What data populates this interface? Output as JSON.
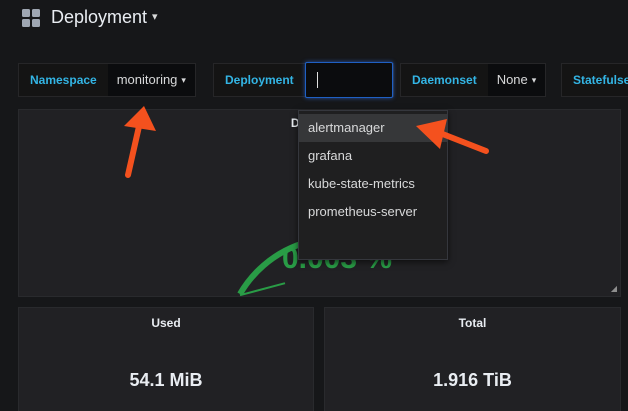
{
  "header": {
    "title": "Deployment"
  },
  "variables": [
    {
      "label": "Namespace",
      "value": "monitoring"
    },
    {
      "label": "Deployment",
      "value": ""
    },
    {
      "label": "Daemonset",
      "value": "None"
    },
    {
      "label": "Statefulset",
      "value": ""
    }
  ],
  "dropdown": {
    "options": [
      "alertmanager",
      "grafana",
      "kube-state-metrics",
      "prometheus-server"
    ],
    "highlighted_index": 0
  },
  "panels": {
    "gauge": {
      "title": "Deployme",
      "value": "0.003 %",
      "fill_fraction": 3e-05
    },
    "used": {
      "title": "Used",
      "value": "54.1 MiB"
    },
    "total": {
      "title": "Total",
      "value": "1.916 TiB"
    }
  },
  "colors": {
    "accent_label": "#33b5e5",
    "gauge_green": "#299c46",
    "gauge_red": "#d44a3a",
    "annotation_arrow": "#f4511e"
  }
}
